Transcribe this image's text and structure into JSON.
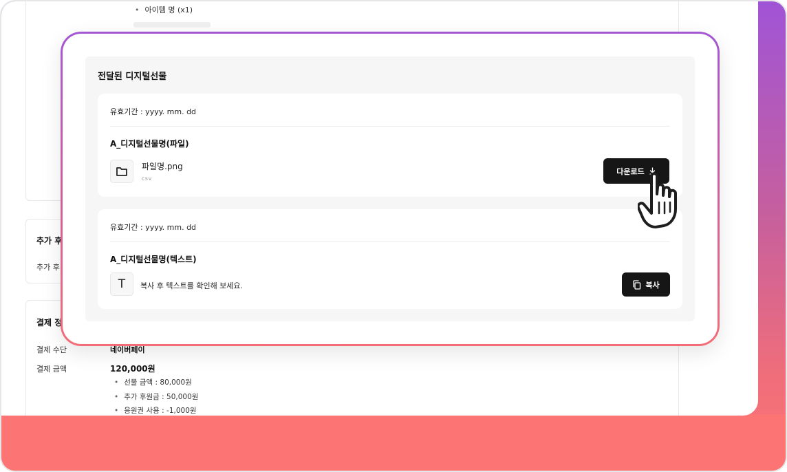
{
  "background_page": {
    "top_card": {
      "bullet_item": "아이템 명 (x1)"
    },
    "extra_section": {
      "heading_visible": "추가 후",
      "row_label_visible": "추가 후"
    },
    "payment_section": {
      "heading_visible": "결제 정",
      "method_label": "결제 수단",
      "method_value": "네이버페이",
      "amount_label": "결제 금액",
      "amount_value": "120,000원",
      "breakdown": [
        "선물 금액 : 80,000원",
        "추가 후원금 : 50,000원",
        "응원권 사용 : -1,000원"
      ]
    }
  },
  "modal": {
    "panel_title": "전달된 디지털선물",
    "file_gift": {
      "validity": "유효기간 : yyyy. mm. dd",
      "name": "A_디지털선물명(파일)",
      "file_name": "파일명.png",
      "file_type": "csv",
      "file_icon": "folder-icon",
      "download_label": "다운로드",
      "download_icon": "download-arrow-icon"
    },
    "text_gift": {
      "validity": "유효기간 : yyyy. mm. dd",
      "name": "A_디지털선물명(텍스트)",
      "icon_glyph": "T",
      "description": "복사 후 텍스트를 확인해 보세요.",
      "copy_label": "복사",
      "copy_icon": "copy-icon"
    }
  },
  "colors": {
    "gradient_top": "#a054d6",
    "gradient_bottom": "#fd7475",
    "button_dark": "#161616",
    "panel_bg": "#f6f6f6"
  }
}
